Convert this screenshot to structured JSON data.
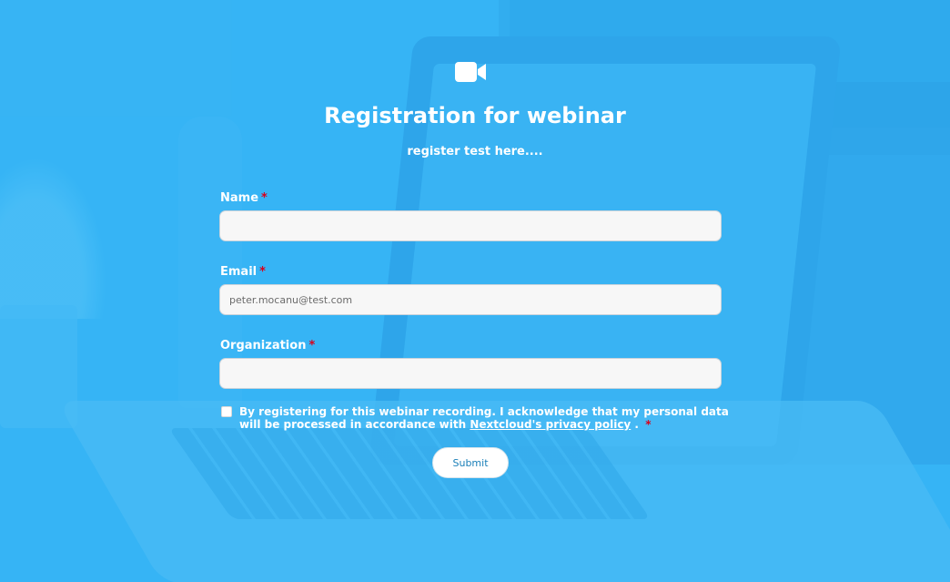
{
  "header": {
    "icon": "video-camera-icon",
    "title": "Registration for webinar",
    "subtitle": "register test here...."
  },
  "form": {
    "name": {
      "label": "Name",
      "required_mark": "*",
      "value": "",
      "placeholder": ""
    },
    "email": {
      "label": "Email",
      "required_mark": "*",
      "value": "",
      "placeholder": "peter.mocanu@test.com"
    },
    "organization": {
      "label": "Organization",
      "required_mark": "*",
      "value": "",
      "placeholder": ""
    },
    "consent": {
      "checked": false,
      "text_before": "By registering for this webinar recording. I acknowledge that my personal data will be processed in accordance with ",
      "link_text": "Nextcloud's privacy policy",
      "text_after": " .",
      "required_mark": "*"
    },
    "submit_label": "Submit"
  },
  "colors": {
    "background": "#3fb9f3",
    "text": "#ffffff",
    "required": "#d9001b",
    "button_text": "#1a7fb8"
  }
}
